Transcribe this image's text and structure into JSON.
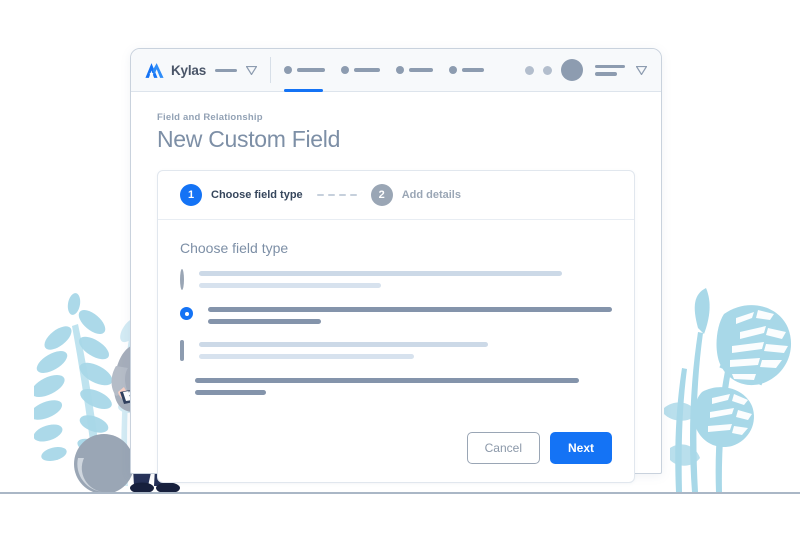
{
  "window": {
    "brand": {
      "name": "Kylas",
      "logo_icon": "kylas-mountain-logo",
      "menu_caret_icon": "triangle-down-icon"
    },
    "nav_items": [
      {
        "name": "nav-item-1",
        "active": true
      },
      {
        "name": "nav-item-2",
        "active": false
      },
      {
        "name": "nav-item-3",
        "active": false
      },
      {
        "name": "nav-item-4",
        "active": false
      }
    ],
    "right_zone": {
      "dot_1_icon": "status-dot-icon",
      "dot_2_icon": "status-dot-icon",
      "avatar_icon": "user-avatar-icon",
      "lines_icon": "account-lines-icon",
      "caret_icon": "chevron-down-icon"
    }
  },
  "page": {
    "breadcrumb": "Field and Relationship",
    "title": "New Custom Field"
  },
  "stepper": {
    "steps": [
      {
        "number": "1",
        "label": "Choose field type",
        "state": "active"
      },
      {
        "number": "2",
        "label": "Add details",
        "state": "inactive"
      }
    ],
    "connector_dashes": 4
  },
  "form": {
    "section_title": "Choose field type",
    "options": [
      {
        "control": "radio",
        "selected": false,
        "bar_widths": [
          "88%",
          "44%"
        ],
        "tone": "dim"
      },
      {
        "control": "radio",
        "selected": true,
        "bar_widths": [
          "100%",
          "28%"
        ],
        "tone": "strong"
      },
      {
        "control": "checkbox",
        "selected": false,
        "bar_widths": [
          "70%",
          "52%"
        ],
        "tone": "dim"
      },
      {
        "control": "checkbox",
        "selected": true,
        "bar_widths": [
          "92%",
          "17%"
        ],
        "tone": "strong"
      }
    ]
  },
  "actions": {
    "cancel_label": "Cancel",
    "next_label": "Next"
  },
  "colors": {
    "accent": "#1473f5",
    "title_text": "#7d8fa6",
    "muted": "#9aa6b5",
    "bar_dim": "#ccd9e7",
    "bar_strong": "#8494ab",
    "plant": "#a8d8e8",
    "skin": "#f7cfc4",
    "hair": "#2c3559",
    "shirt": "#a6aebb",
    "pants": "#253057",
    "ground": "#aab7c6"
  },
  "illustration": {
    "left_plant": "fern-plant-illustration",
    "right_plant": "monstera-plant-illustration",
    "person": "person-holding-tablet-illustration",
    "pot": "plant-pot-illustration"
  }
}
